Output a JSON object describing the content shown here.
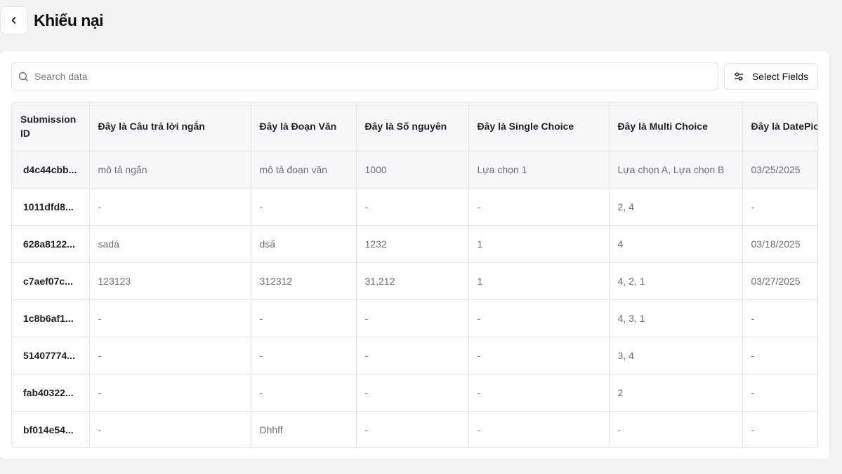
{
  "header": {
    "title": "Khiếu nại"
  },
  "toolbar": {
    "search_placeholder": "Search data",
    "select_fields_label": "Select Fields"
  },
  "table": {
    "columns": [
      "Submission ID",
      "Đây là Câu trả lời ngắn",
      "Đây là Đoạn Văn",
      "Đây là Số nguyên",
      "Đây là Single Choice",
      "Đây là Multi Choice",
      "Đây là DatePicker"
    ],
    "rows": [
      [
        "d4c44cbb...",
        "mô tả ngắn",
        "mô tả đoạn văn",
        "1000",
        "Lựa chọn 1",
        "Lựa chọn A, Lựa chọn B",
        "03/25/2025"
      ],
      [
        "1011dfd8...",
        "-",
        "-",
        "-",
        "-",
        "2, 4",
        "-"
      ],
      [
        "628a8122...",
        "sadá",
        "dsấ",
        "1232",
        "1",
        "4",
        "03/18/2025"
      ],
      [
        "c7aef07c...",
        "123123",
        "312312",
        "31,212",
        "1",
        "4, 2, 1",
        "03/27/2025"
      ],
      [
        "1c8b6af1...",
        "-",
        "-",
        "-",
        "-",
        "4, 3, 1",
        "-"
      ],
      [
        "51407774...",
        "-",
        "-",
        "-",
        "-",
        "3, 4",
        "-"
      ],
      [
        "fab40322...",
        "-",
        "-",
        "-",
        "-",
        "2",
        "-"
      ],
      [
        "bf014e54...",
        "-",
        "Dhhff",
        "-",
        "-",
        "-",
        "-"
      ]
    ]
  }
}
